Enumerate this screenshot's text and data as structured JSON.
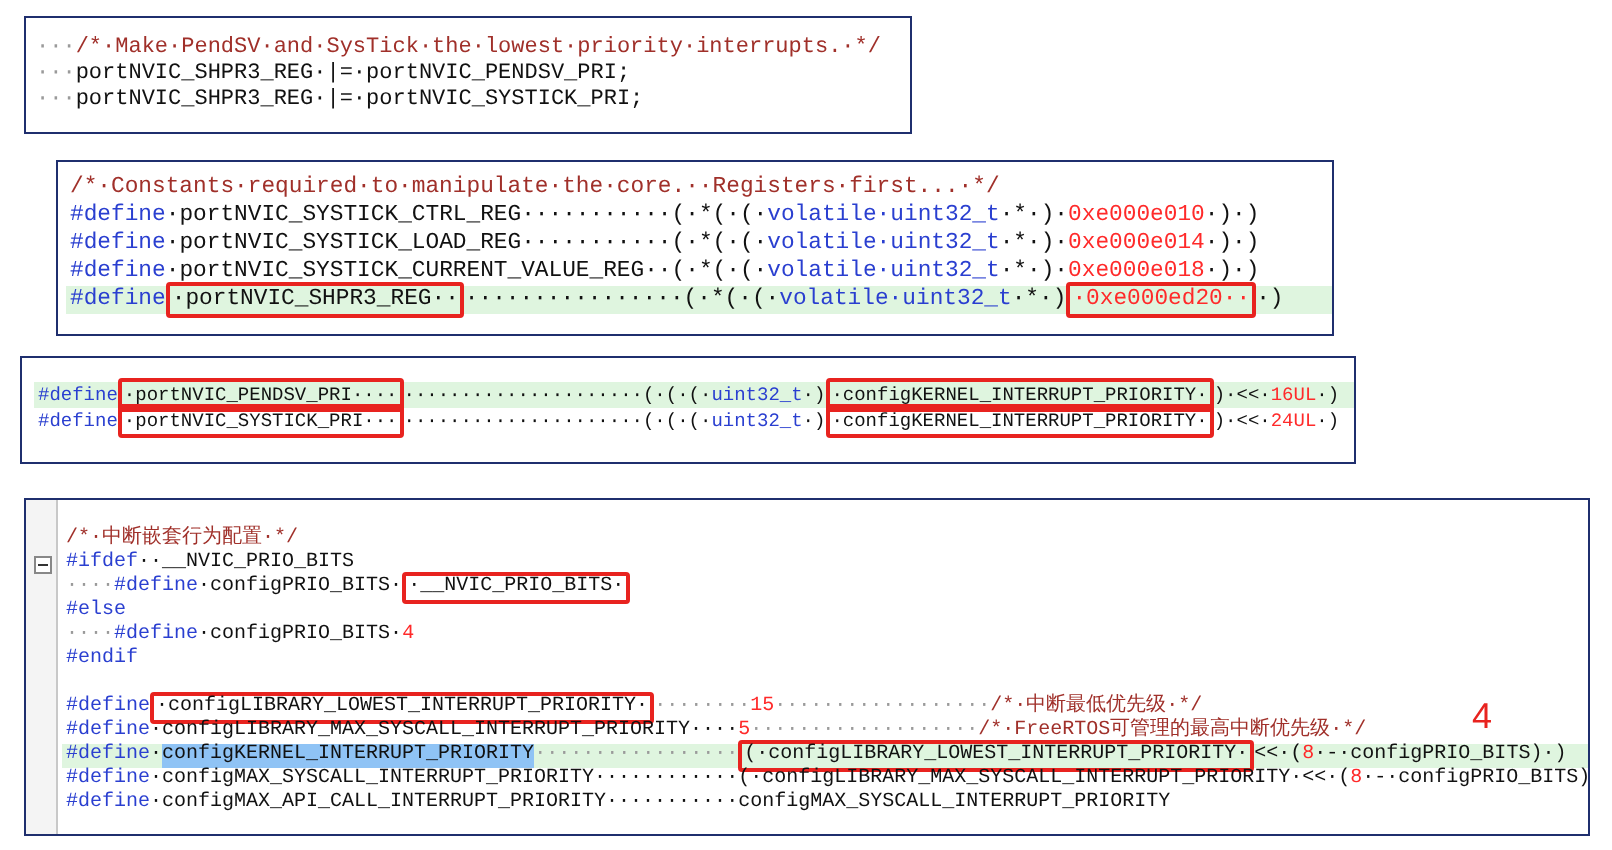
{
  "panels": [
    {
      "lines": [
        {
          "highlighted": false,
          "tokens": [
            {
              "kind": "space",
              "text": "···"
            },
            {
              "kind": "comment",
              "text": "/*·Make·PendSV·and·SysTick·the·lowest·priority·interrupts.·*/"
            }
          ]
        },
        {
          "highlighted": false,
          "tokens": [
            {
              "kind": "space",
              "text": "···"
            },
            {
              "kind": "plain",
              "text": "portNVIC_SHPR3_REG·|=·portNVIC_PENDSV_PRI;"
            }
          ]
        },
        {
          "highlighted": false,
          "tokens": [
            {
              "kind": "space",
              "text": "···"
            },
            {
              "kind": "plain",
              "text": "portNVIC_SHPR3_REG·|=·portNVIC_SYSTICK_PRI;"
            }
          ]
        }
      ]
    },
    {
      "lines": [
        {
          "highlighted": false,
          "tokens": [
            {
              "kind": "comment",
              "text": "/*·Constants·required·to·manipulate·the·core.··Registers·first...·*/"
            }
          ]
        },
        {
          "highlighted": false,
          "tokens": [
            {
              "kind": "directive",
              "text": "#define"
            },
            {
              "kind": "plain",
              "text": "·portNVIC_SYSTICK_CTRL_REG···········(·*(·(·"
            },
            {
              "kind": "type",
              "text": "volatile·uint32_t"
            },
            {
              "kind": "plain",
              "text": "·*·)·"
            },
            {
              "kind": "number",
              "text": "0xe000e010"
            },
            {
              "kind": "plain",
              "text": "·)·)"
            }
          ]
        },
        {
          "highlighted": false,
          "tokens": [
            {
              "kind": "directive",
              "text": "#define"
            },
            {
              "kind": "plain",
              "text": "·portNVIC_SYSTICK_LOAD_REG···········(·*(·(·"
            },
            {
              "kind": "type",
              "text": "volatile·uint32_t"
            },
            {
              "kind": "plain",
              "text": "·*·)·"
            },
            {
              "kind": "number",
              "text": "0xe000e014"
            },
            {
              "kind": "plain",
              "text": "·)·)"
            }
          ]
        },
        {
          "highlighted": false,
          "tokens": [
            {
              "kind": "directive",
              "text": "#define"
            },
            {
              "kind": "plain",
              "text": "·portNVIC_SYSTICK_CURRENT_VALUE_REG··(·*(·(·"
            },
            {
              "kind": "type",
              "text": "volatile·uint32_t"
            },
            {
              "kind": "plain",
              "text": "·*·)·"
            },
            {
              "kind": "number",
              "text": "0xe000e018"
            },
            {
              "kind": "plain",
              "text": "·)·)"
            }
          ]
        },
        {
          "highlighted": true,
          "tokens": [
            {
              "kind": "directive",
              "text": "#define"
            },
            {
              "kind": "plain",
              "text": "·portNVIC_SHPR3_REG··",
              "boxed": true
            },
            {
              "kind": "plain",
              "text": "················(·*(·(·"
            },
            {
              "kind": "type",
              "text": "volatile·uint32_t"
            },
            {
              "kind": "plain",
              "text": "·*·)"
            },
            {
              "kind": "number",
              "text": "·0xe000ed20··",
              "boxed": true
            },
            {
              "kind": "plain",
              "text": "·)"
            }
          ]
        }
      ]
    },
    {
      "lines": [
        {
          "highlighted": true,
          "tokens": [
            {
              "kind": "directive",
              "text": "#define"
            },
            {
              "kind": "plain",
              "text": "·portNVIC_PENDSV_PRI····",
              "boxed": true
            },
            {
              "kind": "plain",
              "text": "·····················(·(·(·"
            },
            {
              "kind": "type",
              "text": "uint32_t"
            },
            {
              "kind": "plain",
              "text": "·)"
            },
            {
              "kind": "plain",
              "text": "·configKERNEL_INTERRUPT_PRIORITY·",
              "boxed": true
            },
            {
              "kind": "plain",
              "text": ")·<<·"
            },
            {
              "kind": "number",
              "text": "16UL"
            },
            {
              "kind": "plain",
              "text": "·)"
            }
          ]
        },
        {
          "highlighted": false,
          "tokens": [
            {
              "kind": "directive",
              "text": "#define"
            },
            {
              "kind": "plain",
              "text": "·portNVIC_SYSTICK_PRI···",
              "boxed": true
            },
            {
              "kind": "plain",
              "text": "·····················(·(·(·"
            },
            {
              "kind": "type",
              "text": "uint32_t"
            },
            {
              "kind": "plain",
              "text": "·)"
            },
            {
              "kind": "plain",
              "text": "·configKERNEL_INTERRUPT_PRIORITY·",
              "boxed": true
            },
            {
              "kind": "plain",
              "text": ")·<<·"
            },
            {
              "kind": "number",
              "text": "24UL"
            },
            {
              "kind": "plain",
              "text": "·)"
            }
          ]
        }
      ]
    },
    {
      "lines": [
        {
          "highlighted": false
        },
        {
          "highlighted": false,
          "tokens": [
            {
              "kind": "comment",
              "text": "/*·中断嵌套行为配置·*/"
            }
          ]
        },
        {
          "highlighted": false,
          "fold": true,
          "tokens": [
            {
              "kind": "directive",
              "text": "#ifdef"
            },
            {
              "kind": "plain",
              "text": "··__NVIC_PRIO_BITS"
            }
          ]
        },
        {
          "highlighted": false,
          "tokens": [
            {
              "kind": "space",
              "text": "····"
            },
            {
              "kind": "directive",
              "text": "#define"
            },
            {
              "kind": "plain",
              "text": "·configPRIO_BITS·"
            },
            {
              "kind": "plain",
              "text": "·__NVIC_PRIO_BITS·",
              "boxed": true
            }
          ]
        },
        {
          "highlighted": false,
          "tokens": [
            {
              "kind": "directive",
              "text": "#else"
            }
          ]
        },
        {
          "highlighted": false,
          "tokens": [
            {
              "kind": "space",
              "text": "····"
            },
            {
              "kind": "directive",
              "text": "#define"
            },
            {
              "kind": "plain",
              "text": "·configPRIO_BITS·"
            },
            {
              "kind": "number",
              "text": "4"
            }
          ]
        },
        {
          "highlighted": false,
          "tokens": [
            {
              "kind": "directive",
              "text": "#endif"
            }
          ]
        },
        {
          "highlighted": false
        },
        {
          "highlighted": false,
          "tokens": [
            {
              "kind": "directive",
              "text": "#define"
            },
            {
              "kind": "plain",
              "text": "·configLIBRARY_LOWEST_INTERRUPT_PRIORITY·",
              "boxed": true
            },
            {
              "kind": "space",
              "text": "········"
            },
            {
              "kind": "number",
              "text": "15"
            },
            {
              "kind": "space",
              "text": "··················"
            },
            {
              "kind": "comment",
              "text": "/*·中断最低优先级·*/"
            }
          ]
        },
        {
          "highlighted": false,
          "note": "4",
          "tokens": [
            {
              "kind": "directive",
              "text": "#define"
            },
            {
              "kind": "plain",
              "text": "·configLIBRARY_MAX_SYSCALL_INTERRUPT_PRIORITY····"
            },
            {
              "kind": "number",
              "text": "5"
            },
            {
              "kind": "space",
              "text": "···················"
            },
            {
              "kind": "comment",
              "text": "/*·FreeRTOS可管理的最高中断优先级·*/"
            }
          ]
        },
        {
          "highlighted": true,
          "tokens": [
            {
              "kind": "directive",
              "text": "#define"
            },
            {
              "kind": "plain",
              "text": "·"
            },
            {
              "kind": "plain",
              "text": "configKERNEL_INTERRUPT_PRIORITY",
              "selected": true
            },
            {
              "kind": "space",
              "text": "·················"
            },
            {
              "kind": "plain",
              "text": "(·configLIBRARY_LOWEST_INTERRUPT_PRIORITY·",
              "boxed": true
            },
            {
              "kind": "plain",
              "text": "<<·("
            },
            {
              "kind": "number",
              "text": "8"
            },
            {
              "kind": "plain",
              "text": "·-·configPRIO_BITS)·)"
            }
          ]
        },
        {
          "highlighted": false,
          "tokens": [
            {
              "kind": "directive",
              "text": "#define"
            },
            {
              "kind": "plain",
              "text": "·configMAX_SYSCALL_INTERRUPT_PRIORITY············(·configLIBRARY_MAX_SYSCALL_INTERRUPT_PRIORITY·<<·("
            },
            {
              "kind": "number",
              "text": "8"
            },
            {
              "kind": "plain",
              "text": "·-·configPRIO_BITS)"
            }
          ]
        },
        {
          "highlighted": false,
          "tokens": [
            {
              "kind": "directive",
              "text": "#define"
            },
            {
              "kind": "plain",
              "text": "·configMAX_API_CALL_INTERRUPT_PRIORITY···········configMAX_SYSCALL_INTERRUPT_PRIORITY"
            }
          ]
        }
      ]
    }
  ]
}
